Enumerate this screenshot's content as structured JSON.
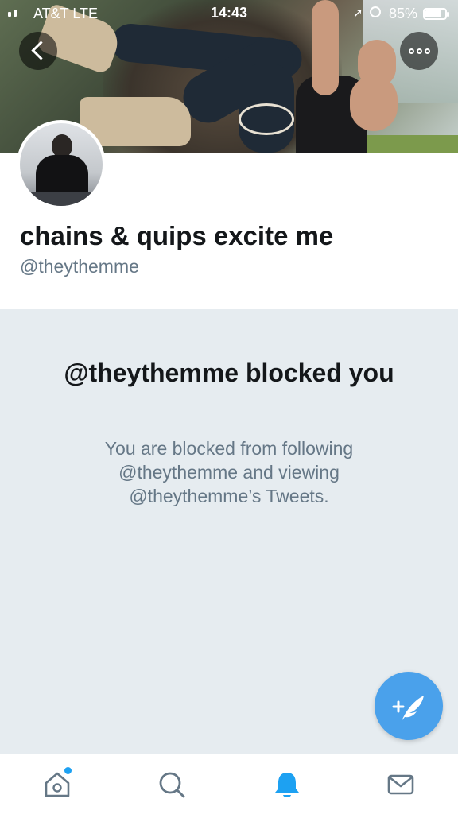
{
  "status_bar": {
    "carrier": "AT&T  LTE",
    "time": "14:43",
    "battery_percent": "85%",
    "battery_level": 0.85,
    "icons": [
      "signal-icon",
      "location-arrow-icon",
      "alarm-icon",
      "battery-icon"
    ]
  },
  "header": {
    "back_icon": "chevron-left-icon",
    "more_icon": "more-dots-icon"
  },
  "profile": {
    "display_name": "chains & quips excite me",
    "handle": "@theythemme"
  },
  "blocked": {
    "title": "@theythemme blocked you",
    "message": "You are blocked from following @theythemme and viewing @theythemme’s Tweets."
  },
  "compose": {
    "icon": "compose-tweet-icon",
    "color": "#4aa1eb"
  },
  "tabbar": {
    "items": [
      {
        "name": "home",
        "icon": "home-icon",
        "has_badge": true
      },
      {
        "name": "search",
        "icon": "search-icon"
      },
      {
        "name": "notifications",
        "icon": "bell-icon",
        "active": true
      },
      {
        "name": "messages",
        "icon": "mail-icon"
      }
    ],
    "active_color": "#1da1f2",
    "inactive_color": "#657786"
  }
}
